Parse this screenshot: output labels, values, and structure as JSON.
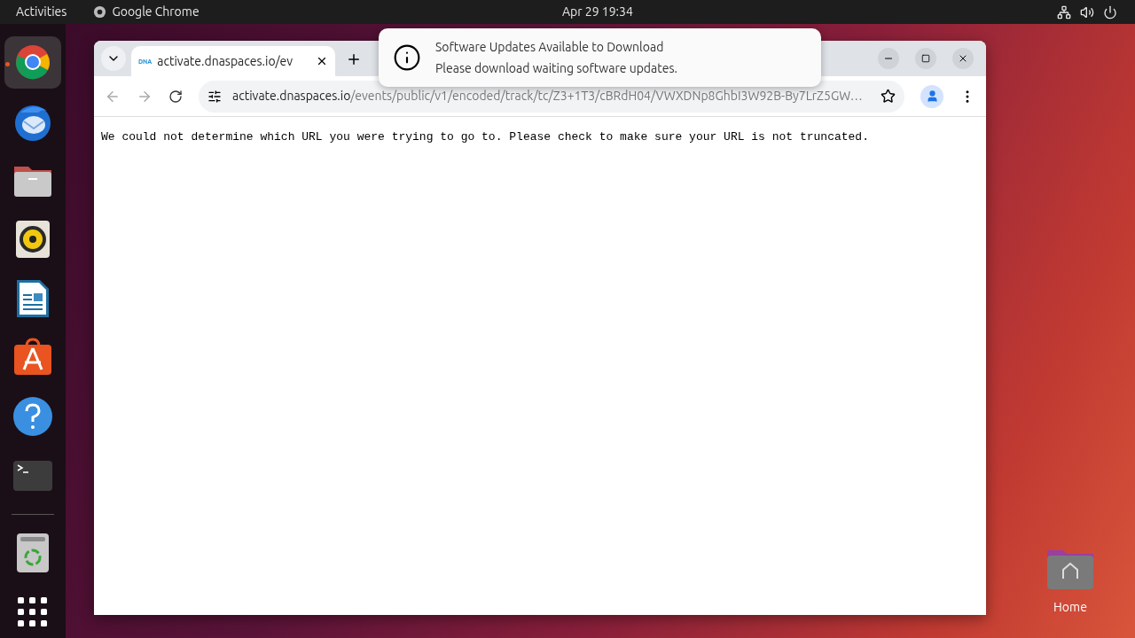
{
  "top_bar": {
    "activities": "Activities",
    "app_name": "Google Chrome",
    "clock": "Apr 29  19:34"
  },
  "dock": [
    {
      "kind": "chrome",
      "running": true
    },
    {
      "kind": "mail",
      "running": false
    },
    {
      "kind": "files",
      "running": false
    },
    {
      "kind": "music",
      "running": false
    },
    {
      "kind": "writer",
      "running": false
    },
    {
      "kind": "store",
      "running": false
    },
    {
      "kind": "help",
      "running": false
    },
    {
      "kind": "terminal",
      "running": false
    }
  ],
  "dock_bottom": [
    {
      "kind": "trash"
    },
    {
      "kind": "apps"
    }
  ],
  "browser": {
    "tabs": [
      {
        "title": "activate.dnaspaces.io/ev",
        "favicon": "DNA",
        "selected": true
      }
    ],
    "url_host": "activate.dnaspaces.io",
    "url_path": "/events/public/v1/encoded/track/tc/Z3+1T3/cBRdH04/VWXDNp8GhbI3W92B-By7LrZ5GW…",
    "page_text": "We could not determine which URL you were trying to go to. Please check to make sure your URL is not truncated."
  },
  "notification": {
    "title": "Software Updates Available to Download",
    "body": "Please download waiting software updates."
  },
  "desktop_icons": [
    {
      "label": "Home"
    }
  ]
}
